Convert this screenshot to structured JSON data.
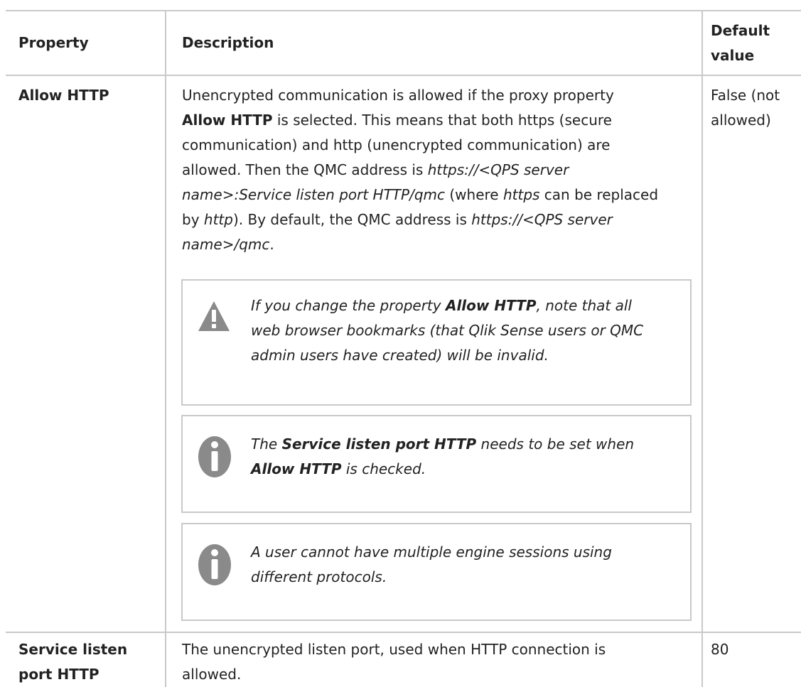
{
  "table": {
    "headers": {
      "property": "Property",
      "description": "Description",
      "default_line1": "Default",
      "default_line2": "value"
    },
    "rows": [
      {
        "property": "Allow HTTP",
        "description": {
          "line1": "Unencrypted communication is allowed if the proxy property",
          "line2_bold": "Allow HTTP",
          "line2_rest": " is selected. This means that both https (secure",
          "line3": "communication) and http (unencrypted communication) are",
          "line4_a": "allowed. Then the QMC address is ",
          "line4_em": "https://<QPS server",
          "line5_em": "name>:Service listen port HTTP/qmc",
          "line5_rest_a": " (where ",
          "line5_em2": "https",
          "line5_rest_b": " can be replaced",
          "line6_a": "by ",
          "line6_em": "http",
          "line6_b": "). By default, the QMC address is ",
          "line6_em2": "https://<QPS server",
          "line7_em": "name>/qmc",
          "line7_rest": "."
        },
        "default_line1": "False (not",
        "default_line2": "allowed)",
        "notes": [
          {
            "icon": "warning-icon",
            "line1_a": "If you change the property ",
            "line1_b": "Allow HTTP",
            "line1_c": ", note that all",
            "line2": "web browser bookmarks (that Qlik Sense users or QMC",
            "line3": "admin users have created) will be invalid."
          },
          {
            "icon": "info-icon",
            "line1_a": "The ",
            "line1_b": "Service listen port HTTP",
            "line1_c": " needs to be set when",
            "line2_b": "Allow HTTP",
            "line2_c": " is checked."
          },
          {
            "icon": "info-icon",
            "line1": "A user cannot have multiple engine sessions using",
            "line2": "different protocols."
          }
        ]
      },
      {
        "property_line1": "Service listen",
        "property_line2": "port HTTP",
        "description_line1": "The unencrypted listen port, used when HTTP connection is",
        "description_line2": "allowed.",
        "default": "80"
      }
    ]
  },
  "colors": {
    "border": "#c9c9c9",
    "icon_gray": "#8a8a8a",
    "text": "#222222"
  }
}
